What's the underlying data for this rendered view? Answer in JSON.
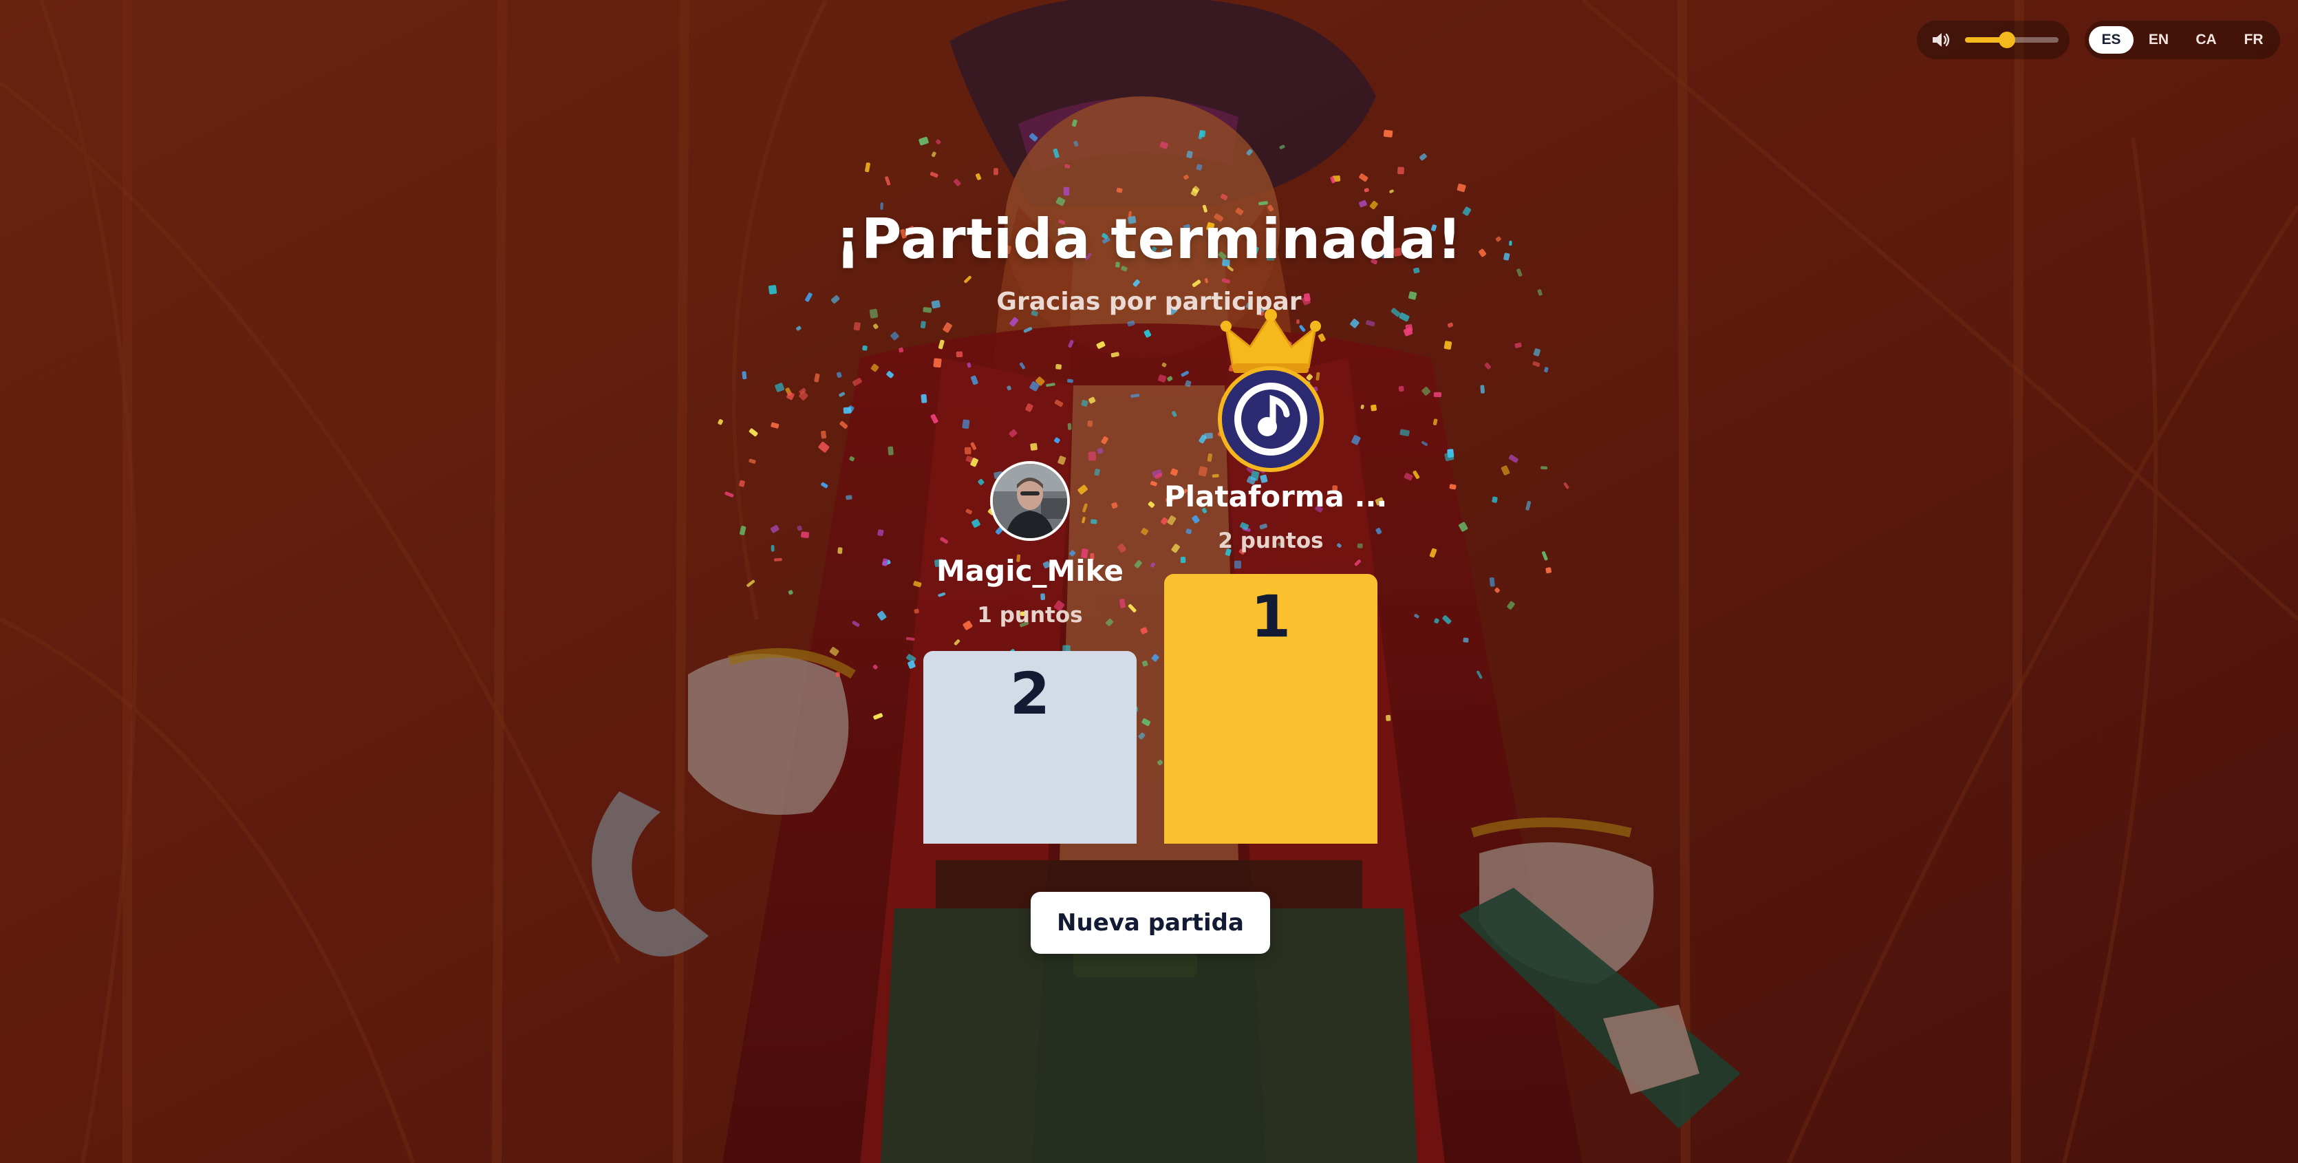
{
  "header": {
    "title": "¡Partida terminada!",
    "subtitle": "Gracias por participar"
  },
  "controls": {
    "volume_level": 0.45,
    "languages": [
      {
        "code": "ES",
        "active": true
      },
      {
        "code": "EN",
        "active": false
      },
      {
        "code": "CA",
        "active": false
      },
      {
        "code": "FR",
        "active": false
      }
    ]
  },
  "podium": {
    "first": {
      "rank": "1",
      "name": "Plataforma ...",
      "points": "2 puntos",
      "avatar_icon": "music-note-logo-icon",
      "crown_icon": "crown-icon"
    },
    "second": {
      "rank": "2",
      "name": "Magic_Mike",
      "points": "1 puntos",
      "avatar_icon": "user-photo-avatar"
    }
  },
  "actions": {
    "new_game_label": "Nueva partida"
  },
  "colors": {
    "accent_gold": "#f6b91d",
    "first_podium": "#fbc02d",
    "second_podium": "#d3dbe6",
    "dark_text": "#131a33",
    "background": "#7a2414"
  }
}
